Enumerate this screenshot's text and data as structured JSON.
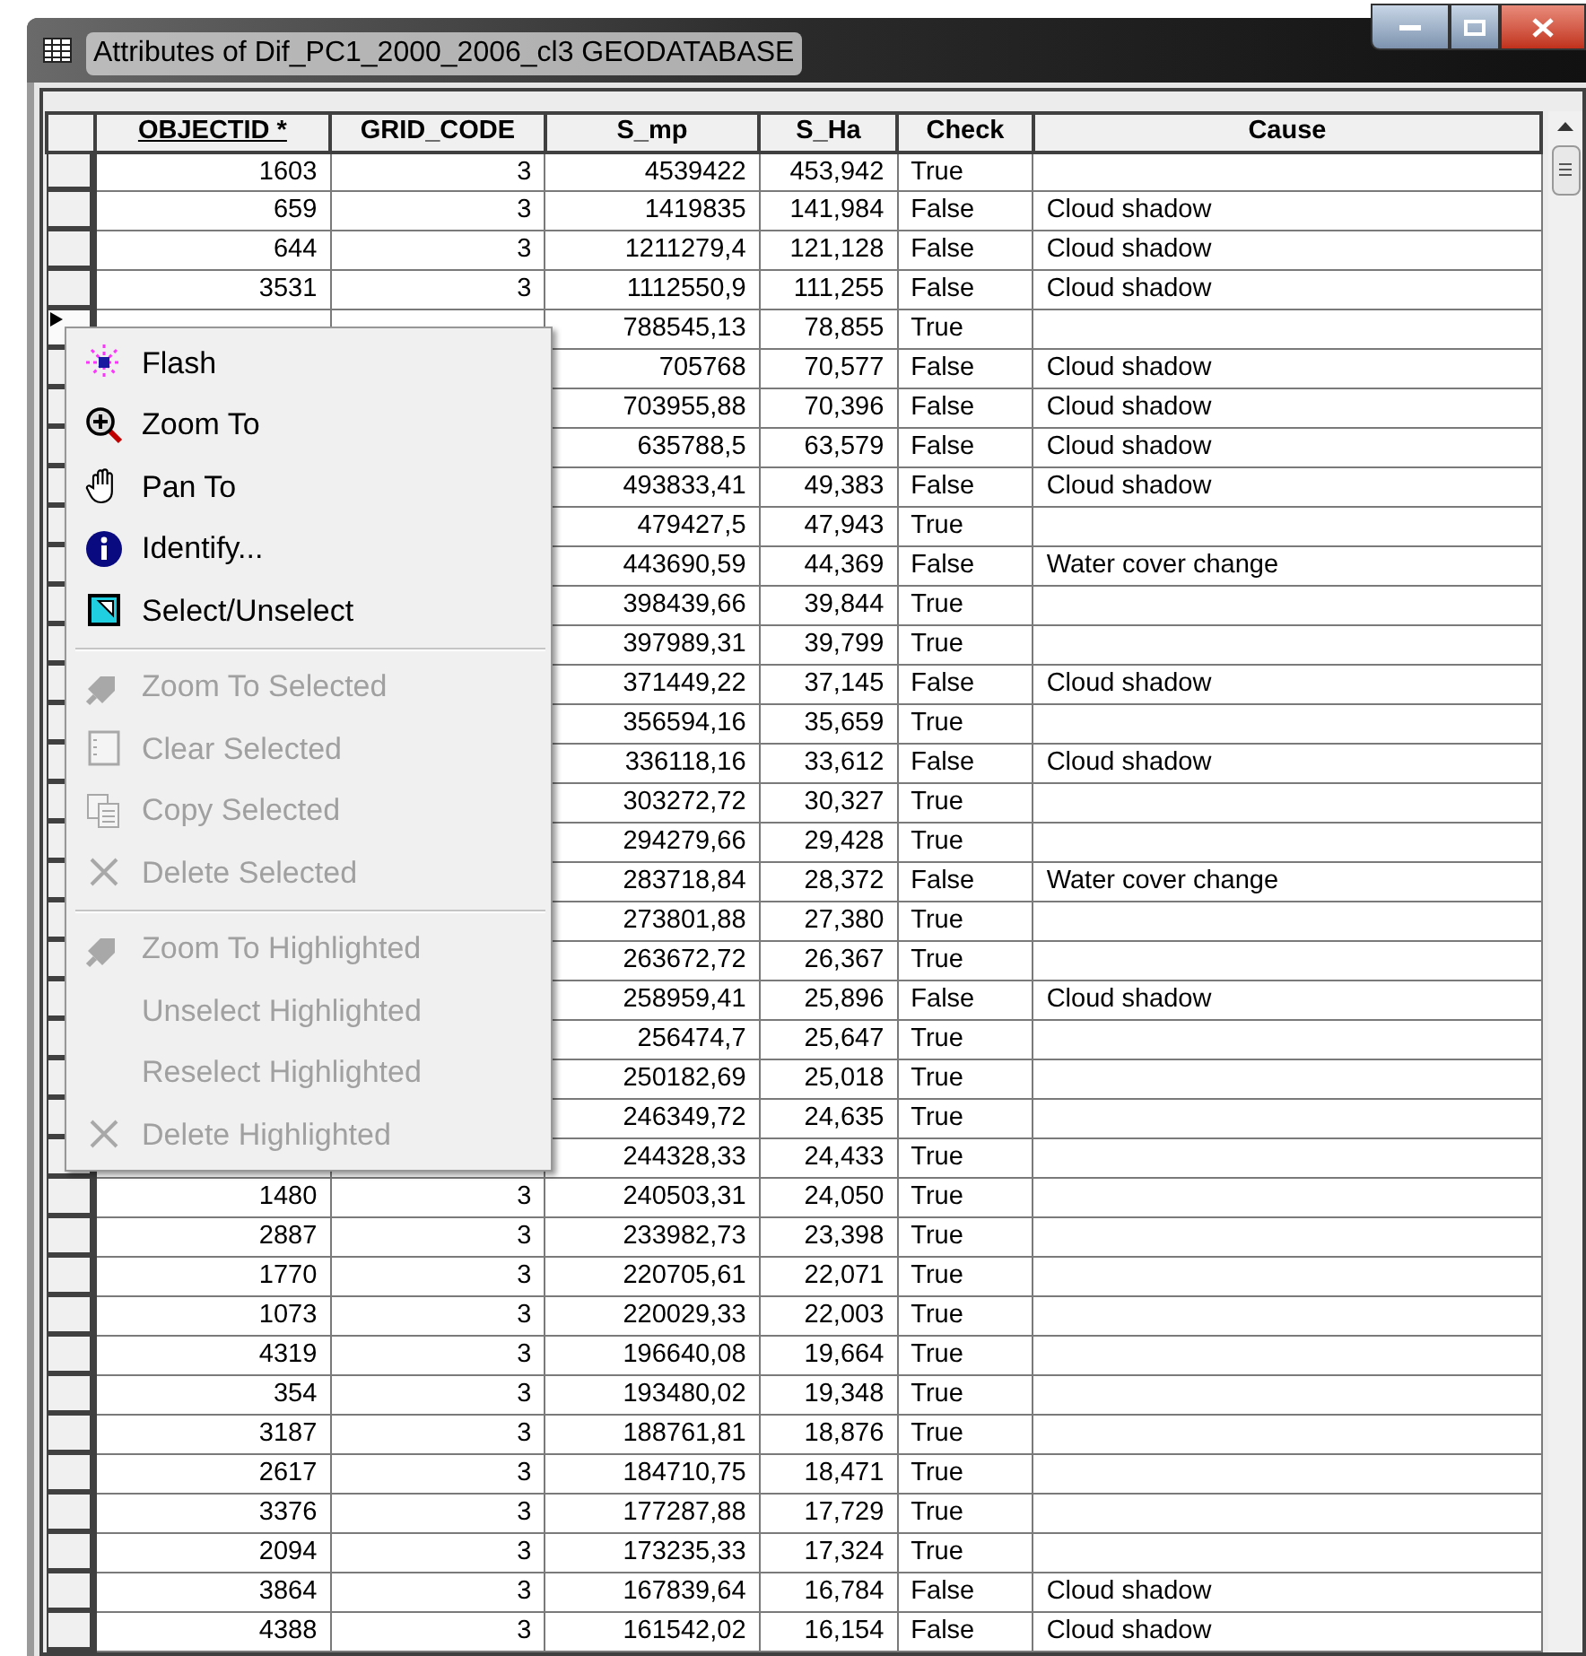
{
  "window": {
    "title": "Attributes of Dif_PC1_2000_2006_cl3 GEODATABASE"
  },
  "table": {
    "columns": [
      {
        "label": "OBJECTID *",
        "sorted": true
      },
      {
        "label": "GRID_CODE",
        "sorted": false
      },
      {
        "label": "S_mp",
        "sorted": false
      },
      {
        "label": "S_Ha",
        "sorted": false
      },
      {
        "label": "Check",
        "sorted": false
      },
      {
        "label": "Cause",
        "sorted": false
      }
    ],
    "rows": [
      {
        "objectid": "1603",
        "grid_code": "3",
        "s_mp": "4539422",
        "s_ha": "453,942",
        "check": "True",
        "current": false
      },
      {
        "objectid": "659",
        "grid_code": "3",
        "s_mp": "1419835",
        "s_ha": "141,984",
        "check": "False",
        "cause": "Cloud shadow",
        "current": false
      },
      {
        "objectid": "644",
        "grid_code": "3",
        "s_mp": "1211279,4",
        "s_ha": "121,128",
        "check": "False",
        "cause": "Cloud shadow",
        "current": false
      },
      {
        "objectid": "3531",
        "grid_code": "3",
        "s_mp": "1112550,9",
        "s_ha": "111,255",
        "check": "False",
        "cause": "Cloud shadow",
        "current": false
      },
      {
        "s_mp": "788545,13",
        "s_ha": "78,855",
        "check": "True",
        "current": true
      },
      {
        "s_mp": "705768",
        "s_ha": "70,577",
        "check": "False",
        "cause": "Cloud shadow",
        "current": false
      },
      {
        "s_mp": "703955,88",
        "s_ha": "70,396",
        "check": "False",
        "cause": "Cloud shadow",
        "current": false
      },
      {
        "s_mp": "635788,5",
        "s_ha": "63,579",
        "check": "False",
        "cause": "Cloud shadow",
        "current": false
      },
      {
        "s_mp": "493833,41",
        "s_ha": "49,383",
        "check": "False",
        "cause": "Cloud shadow",
        "current": false
      },
      {
        "s_mp": "479427,5",
        "s_ha": "47,943",
        "check": "True",
        "current": false
      },
      {
        "s_mp": "443690,59",
        "s_ha": "44,369",
        "check": "False",
        "cause": "Water cover change",
        "current": false
      },
      {
        "s_mp": "398439,66",
        "s_ha": "39,844",
        "check": "True",
        "current": false
      },
      {
        "s_mp": "397989,31",
        "s_ha": "39,799",
        "check": "True",
        "current": false
      },
      {
        "s_mp": "371449,22",
        "s_ha": "37,145",
        "check": "False",
        "cause": "Cloud shadow",
        "current": false
      },
      {
        "s_mp": "356594,16",
        "s_ha": "35,659",
        "check": "True",
        "current": false
      },
      {
        "s_mp": "336118,16",
        "s_ha": "33,612",
        "check": "False",
        "cause": "Cloud shadow",
        "current": false
      },
      {
        "s_mp": "303272,72",
        "s_ha": "30,327",
        "check": "True",
        "current": false
      },
      {
        "s_mp": "294279,66",
        "s_ha": "29,428",
        "check": "True",
        "current": false
      },
      {
        "s_mp": "283718,84",
        "s_ha": "28,372",
        "check": "False",
        "cause": "Water cover change",
        "current": false
      },
      {
        "s_mp": "273801,88",
        "s_ha": "27,380",
        "check": "True",
        "current": false
      },
      {
        "s_mp": "263672,72",
        "s_ha": "26,367",
        "check": "True",
        "current": false
      },
      {
        "s_mp": "258959,41",
        "s_ha": "25,896",
        "check": "False",
        "cause": "Cloud shadow",
        "current": false
      },
      {
        "s_mp": "256474,7",
        "s_ha": "25,647",
        "check": "True",
        "current": false
      },
      {
        "s_mp": "250182,69",
        "s_ha": "25,018",
        "check": "True",
        "current": false
      },
      {
        "s_mp": "246349,72",
        "s_ha": "24,635",
        "check": "True",
        "current": false
      },
      {
        "s_mp": "244328,33",
        "s_ha": "24,433",
        "check": "True",
        "current": false
      },
      {
        "objectid": "1480",
        "grid_code": "3",
        "s_mp": "240503,31",
        "s_ha": "24,050",
        "check": "True",
        "current": false
      },
      {
        "objectid": "2887",
        "grid_code": "3",
        "s_mp": "233982,73",
        "s_ha": "23,398",
        "check": "True",
        "current": false
      },
      {
        "objectid": "1770",
        "grid_code": "3",
        "s_mp": "220705,61",
        "s_ha": "22,071",
        "check": "True",
        "current": false
      },
      {
        "objectid": "1073",
        "grid_code": "3",
        "s_mp": "220029,33",
        "s_ha": "22,003",
        "check": "True",
        "current": false
      },
      {
        "objectid": "4319",
        "grid_code": "3",
        "s_mp": "196640,08",
        "s_ha": "19,664",
        "check": "True",
        "current": false
      },
      {
        "objectid": "354",
        "grid_code": "3",
        "s_mp": "193480,02",
        "s_ha": "19,348",
        "check": "True",
        "current": false
      },
      {
        "objectid": "3187",
        "grid_code": "3",
        "s_mp": "188761,81",
        "s_ha": "18,876",
        "check": "True",
        "current": false
      },
      {
        "objectid": "2617",
        "grid_code": "3",
        "s_mp": "184710,75",
        "s_ha": "18,471",
        "check": "True",
        "current": false
      },
      {
        "objectid": "3376",
        "grid_code": "3",
        "s_mp": "177287,88",
        "s_ha": "17,729",
        "check": "True",
        "current": false
      },
      {
        "objectid": "2094",
        "grid_code": "3",
        "s_mp": "173235,33",
        "s_ha": "17,324",
        "check": "True",
        "current": false
      },
      {
        "objectid": "3864",
        "grid_code": "3",
        "s_mp": "167839,64",
        "s_ha": "16,784",
        "check": "False",
        "cause": "Cloud shadow",
        "current": false
      },
      {
        "objectid": "4388",
        "grid_code": "3",
        "s_mp": "161542,02",
        "s_ha": "16,154",
        "check": "False",
        "cause": "Cloud shadow",
        "current": false
      }
    ]
  },
  "context_menu": {
    "items": [
      {
        "kind": "item",
        "label": "Flash",
        "disabled": false
      },
      {
        "kind": "item",
        "label": "Zoom To",
        "disabled": false
      },
      {
        "kind": "item",
        "label": "Pan To",
        "disabled": false
      },
      {
        "kind": "item",
        "label": "Identify...",
        "disabled": false
      },
      {
        "kind": "item",
        "label": "Select/Unselect",
        "disabled": false
      },
      {
        "kind": "separator"
      },
      {
        "kind": "item",
        "label": "Zoom To Selected",
        "disabled": true
      },
      {
        "kind": "item",
        "label": "Clear Selected",
        "disabled": true
      },
      {
        "kind": "item",
        "label": "Copy Selected",
        "disabled": true
      },
      {
        "kind": "item",
        "label": "Delete Selected",
        "disabled": true
      },
      {
        "kind": "separator"
      },
      {
        "kind": "item",
        "label": "Zoom To Highlighted",
        "disabled": true
      },
      {
        "kind": "item",
        "label": "Unselect Highlighted",
        "disabled": true
      },
      {
        "kind": "item",
        "label": "Reselect Highlighted",
        "disabled": true
      },
      {
        "kind": "item",
        "label": "Delete Highlighted",
        "disabled": true
      }
    ]
  }
}
